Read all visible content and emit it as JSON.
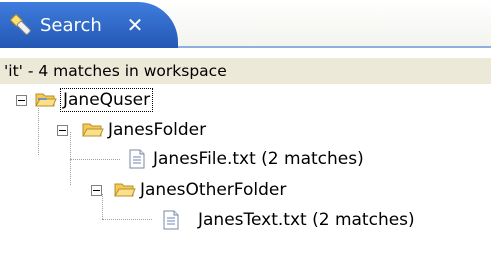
{
  "tab": {
    "label": "Search",
    "close_glyph": "✕",
    "icon": "search-flashlight-icon"
  },
  "status": {
    "text": "'it' - 4 matches in workspace"
  },
  "tree": {
    "root": {
      "label": "JaneQuser",
      "icon": "open-folder-icon",
      "expanded": true,
      "selected": true
    },
    "folder1": {
      "label": "JanesFolder",
      "icon": "open-folder-icon",
      "expanded": true
    },
    "file1": {
      "label": "JanesFile.txt (2 matches)",
      "icon": "text-file-icon"
    },
    "folder2": {
      "label": "JanesOtherFolder",
      "icon": "open-folder-icon",
      "expanded": true
    },
    "file2": {
      "label": "JanesText.txt (2 matches)",
      "icon": "text-file-icon"
    }
  },
  "colors": {
    "tab_active": "#2f6acb",
    "status_bar": "#ece9d8",
    "folder": "#f5c955"
  }
}
